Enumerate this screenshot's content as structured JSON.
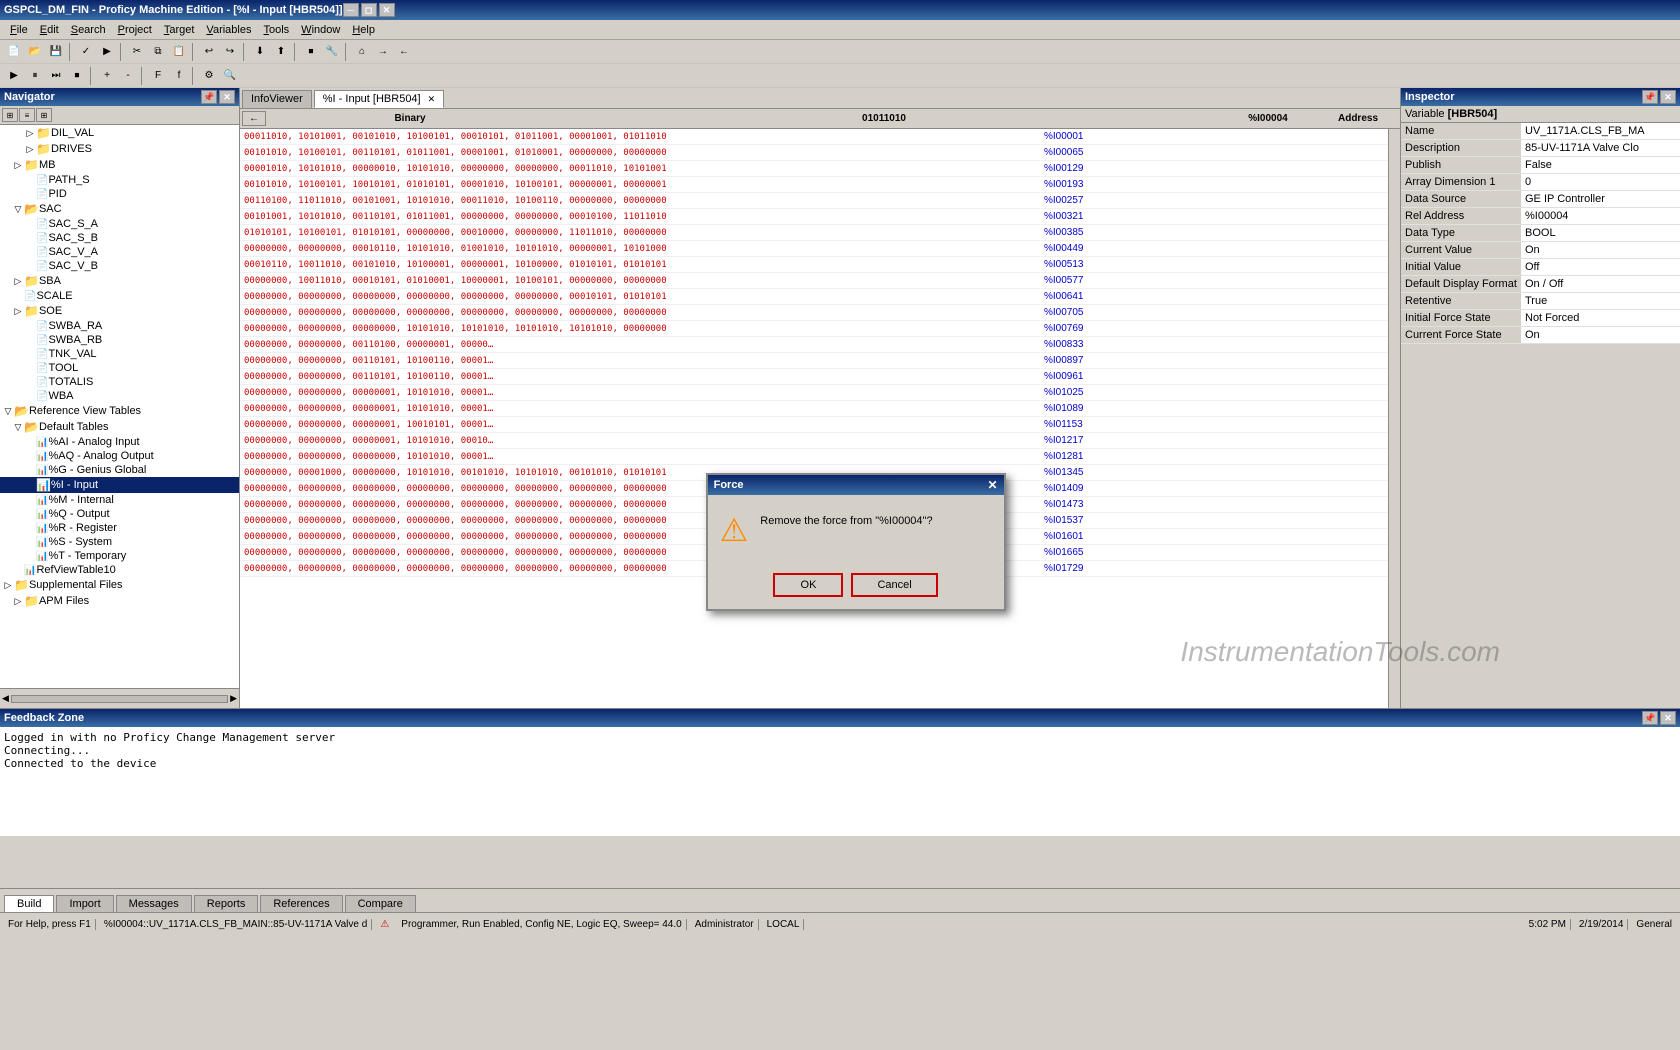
{
  "titleBar": {
    "text": "GSPCL_DM_FIN - Proficy Machine Edition - [%I - Input [HBR504]]",
    "buttons": [
      "minimize",
      "restore",
      "close"
    ]
  },
  "menuBar": {
    "items": [
      "File",
      "Edit",
      "Search",
      "Project",
      "Target",
      "Variables",
      "Tools",
      "Window",
      "Help"
    ]
  },
  "navigator": {
    "title": "Navigator",
    "tree": [
      {
        "label": "DIL_VAL",
        "level": 2,
        "type": "folder"
      },
      {
        "label": "DRIVES",
        "level": 2,
        "type": "folder"
      },
      {
        "label": "MB",
        "level": 1,
        "type": "folder"
      },
      {
        "label": "PATH_S",
        "level": 2,
        "type": "file"
      },
      {
        "label": "PID",
        "level": 2,
        "type": "file"
      },
      {
        "label": "SAC",
        "level": 1,
        "type": "folder"
      },
      {
        "label": "SAC_S_A",
        "level": 2,
        "type": "file"
      },
      {
        "label": "SAC_S_B",
        "level": 2,
        "type": "file"
      },
      {
        "label": "SAC_V_A",
        "level": 2,
        "type": "file"
      },
      {
        "label": "SAC_V_B",
        "level": 2,
        "type": "file"
      },
      {
        "label": "SBA",
        "level": 1,
        "type": "folder"
      },
      {
        "label": "SCALE",
        "level": 1,
        "type": "file"
      },
      {
        "label": "SOE",
        "level": 1,
        "type": "folder"
      },
      {
        "label": "SWBA_RA",
        "level": 2,
        "type": "file"
      },
      {
        "label": "SWBA_RB",
        "level": 2,
        "type": "file"
      },
      {
        "label": "TNK_VAL",
        "level": 2,
        "type": "file"
      },
      {
        "label": "TOOL",
        "level": 2,
        "type": "file"
      },
      {
        "label": "TOTALIS",
        "level": 2,
        "type": "file"
      },
      {
        "label": "WBA",
        "level": 2,
        "type": "file"
      },
      {
        "label": "Reference View Tables",
        "level": 0,
        "type": "folder"
      },
      {
        "label": "Default Tables",
        "level": 1,
        "type": "folder"
      },
      {
        "label": "%AI - Analog Input",
        "level": 2,
        "type": "file"
      },
      {
        "label": "%AQ - Analog Output",
        "level": 2,
        "type": "file"
      },
      {
        "label": "%G - Genius Global",
        "level": 2,
        "type": "file"
      },
      {
        "label": "%I - Input",
        "level": 2,
        "type": "file",
        "selected": true
      },
      {
        "label": "%M - Internal",
        "level": 2,
        "type": "file"
      },
      {
        "label": "%Q - Output",
        "level": 2,
        "type": "file"
      },
      {
        "label": "%R - Register",
        "level": 2,
        "type": "file"
      },
      {
        "label": "%S - System",
        "level": 2,
        "type": "file"
      },
      {
        "label": "%T - Temporary",
        "level": 2,
        "type": "file"
      },
      {
        "label": "RefViewTable10",
        "level": 1,
        "type": "file"
      },
      {
        "label": "Supplemental Files",
        "level": 0,
        "type": "folder"
      },
      {
        "label": "APM Files",
        "level": 1,
        "type": "folder"
      }
    ]
  },
  "infoViewer": {
    "tab": "InfoViewer",
    "activeTab": "%I - Input [HBR504]"
  },
  "binaryView": {
    "navButton": "←",
    "columns": [
      "Binary",
      "01011010",
      "%I00004",
      "Address"
    ],
    "rows": [
      {
        "data": "00011010, 10101001, 00101010, 10100101, 00010101, 01011001, 00001001, 01011010",
        "addr": "%I00001"
      },
      {
        "data": "00101010, 10100101, 00110101, 01011001, 00001001, 01010001, 00000000, 00000000",
        "addr": "%I00065"
      },
      {
        "data": "00001010, 10101010, 00000010, 10101010, 00000000, 00000000, 00011010, 10101001",
        "addr": "%I00129"
      },
      {
        "data": "00101010, 10100101, 10010101, 01010101, 00001010, 10100101, 00000001, 00000001",
        "addr": "%I00193"
      },
      {
        "data": "00110100, 11011010, 00101001, 10101010, 00011010, 10100110, 00000000, 00000000",
        "addr": "%I00257"
      },
      {
        "data": "00101001, 10101010, 00110101, 01011001, 00000000, 00000000, 00010100, 11011010",
        "addr": "%I00321"
      },
      {
        "data": "01010101, 10100101, 01010101, 00000000, 00010000, 00000000, 11011010, 00000000",
        "addr": "%I00385"
      },
      {
        "data": "00000000, 00000000, 00010110, 10101010, 01001010, 10101010, 00000001, 10101000",
        "addr": "%I00449"
      },
      {
        "data": "00010110, 10011010, 00101010, 10100001, 00000001, 10100000, 01010101, 01010101",
        "addr": "%I00513"
      },
      {
        "data": "00000000, 10011010, 00010101, 01010001, 10000001, 10100101, 00000000, 00000000",
        "addr": "%I00577"
      },
      {
        "data": "00000000, 00000000, 00000000, 00000000, 00000000, 00000000, 00010101, 01010101",
        "addr": "%I00641"
      },
      {
        "data": "00000000, 00000000, 00000000, 00000000, 00000000, 00000000, 00000000, 00000000",
        "addr": "%I00705"
      },
      {
        "data": "00000000, 00000000, 00000000, 10101010, 10101010, 10101010, 10101010, 00000000",
        "addr": "%I00769"
      },
      {
        "data": "00000000, 00000000, 00110100, 00000001, 00000…",
        "addr": "%I00833"
      },
      {
        "data": "00000000, 00000000, 00110101, 10100110, 00001…",
        "addr": "%I00897"
      },
      {
        "data": "00000000, 00000000, 00110101, 10100110, 00001…",
        "addr": "%I00961"
      },
      {
        "data": "00000000, 00000000, 00000001, 10101010, 00001…",
        "addr": "%I01025"
      },
      {
        "data": "00000000, 00000000, 00000001, 10101010, 00001…",
        "addr": "%I01089"
      },
      {
        "data": "00000000, 00000000, 00000001, 10010101, 00001…",
        "addr": "%I01153"
      },
      {
        "data": "00000000, 00000000, 00000001, 10101010, 00010…",
        "addr": "%I01217"
      },
      {
        "data": "00000000, 00000000, 00000000, 10101010, 00001…",
        "addr": "%I01281"
      },
      {
        "data": "00000000, 00001000, 00000000, 10101010, 00101010, 10101010, 00101010, 01010101",
        "addr": "%I01345"
      },
      {
        "data": "00000000, 00000000, 00000000, 00000000, 00000000, 00000000, 00000000, 00000000",
        "addr": "%I01409"
      },
      {
        "data": "00000000, 00000000, 00000000, 00000000, 00000000, 00000000, 00000000, 00000000",
        "addr": "%I01473"
      },
      {
        "data": "00000000, 00000000, 00000000, 00000000, 00000000, 00000000, 00000000, 00000000",
        "addr": "%I01537"
      },
      {
        "data": "00000000, 00000000, 00000000, 00000000, 00000000, 00000000, 00000000, 00000000",
        "addr": "%I01601"
      },
      {
        "data": "00000000, 00000000, 00000000, 00000000, 00000000, 00000000, 00000000, 00000000",
        "addr": "%I01665"
      },
      {
        "data": "00000000, 00000000, 00000000, 00000000, 00000000, 00000000, 00000000, 00000000",
        "addr": "%I01729"
      }
    ]
  },
  "inspector": {
    "title": "Inspector",
    "variable": "[HBR504]",
    "properties": [
      {
        "name": "Name",
        "value": "UV_1171A.CLS_FB_MA"
      },
      {
        "name": "Description",
        "value": "85-UV-1171A Valve Clo"
      },
      {
        "name": "Publish",
        "value": "False"
      },
      {
        "name": "Array Dimension 1",
        "value": "0"
      },
      {
        "name": "Data Source",
        "value": "GE IP Controller"
      },
      {
        "name": "Rel Address",
        "value": "%I00004"
      },
      {
        "name": "Data Type",
        "value": "BOOL"
      },
      {
        "name": "Current Value",
        "value": "On"
      },
      {
        "name": "Initial Value",
        "value": "Off"
      },
      {
        "name": "Default Display Format",
        "value": "On / Off"
      },
      {
        "name": "Retentive",
        "value": "True"
      },
      {
        "name": "Initial Force State",
        "value": "Not Forced"
      },
      {
        "name": "Current Force State",
        "value": "On"
      }
    ]
  },
  "feedbackZone": {
    "title": "Feedback Zone",
    "messages": [
      "Logged in with no Proficy Change Management server",
      "Connecting...",
      "Connected to the device"
    ]
  },
  "bottomTabs": {
    "tabs": [
      "Build",
      "Import",
      "Messages",
      "Reports",
      "References",
      "Compare"
    ]
  },
  "statusBar": {
    "helpText": "For Help, press F1",
    "address": "%I00004::UV_1171A.CLS_FB_MAIN::85-UV-1171A Valve d",
    "mode": "Programmer, Run Enabled, Config NE, Logic EQ, Sweep= 44.0",
    "user": "Administrator",
    "location": "LOCAL",
    "time": "5:02 PM",
    "date": "2/19/2014"
  },
  "dialog": {
    "title": "Force",
    "message": "Remove the force from \"%I00004\"?",
    "okLabel": "OK",
    "cancelLabel": "Cancel"
  },
  "watermark": "InstrumentationTools.com"
}
